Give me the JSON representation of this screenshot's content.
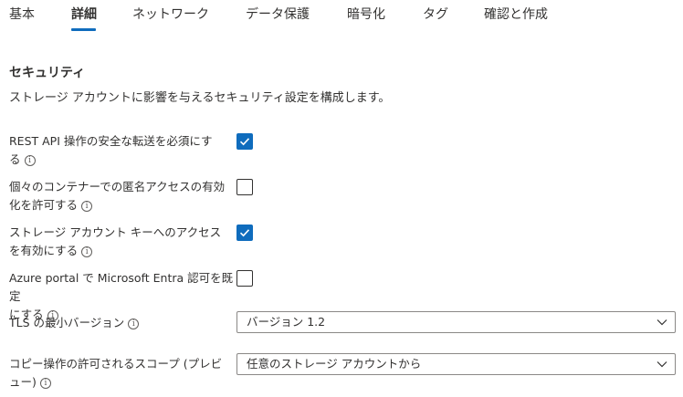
{
  "tabs": [
    {
      "label": "基本"
    },
    {
      "label": "詳細"
    },
    {
      "label": "ネットワーク"
    },
    {
      "label": "データ保護"
    },
    {
      "label": "暗号化"
    },
    {
      "label": "タグ"
    },
    {
      "label": "確認と作成"
    }
  ],
  "active_tab": "詳細",
  "section": {
    "title": "セキュリティ",
    "description": "ストレージ アカウントに影響を与えるセキュリティ設定を構成します。"
  },
  "settings": [
    {
      "line1": "REST API 操作の安全な転送を必須にす",
      "line2": "る",
      "checked": true
    },
    {
      "line1": "個々のコンテナーでの匿名アクセスの有効",
      "line2": "化を許可する",
      "checked": false
    },
    {
      "line1": "ストレージ アカウント キーへのアクセス",
      "line2": "を有効にする",
      "checked": true
    },
    {
      "line1": "Azure portal で Microsoft Entra 認可を既定",
      "line2": "にする",
      "checked": false
    }
  ],
  "tls": {
    "label": "TLS の最小バージョン",
    "value": "バージョン 1.2"
  },
  "copy_scope": {
    "line1": "コピー操作の許可されるスコープ (プレビ",
    "line2": "ュー)",
    "value": "任意のストレージ アカウントから"
  },
  "icons": {
    "info": "info-icon",
    "check": "checkmark-icon",
    "chevron": "chevron-down-icon"
  },
  "colors": {
    "accent": "#0f6cbd",
    "text": "#323130",
    "border": "#8a8886"
  }
}
